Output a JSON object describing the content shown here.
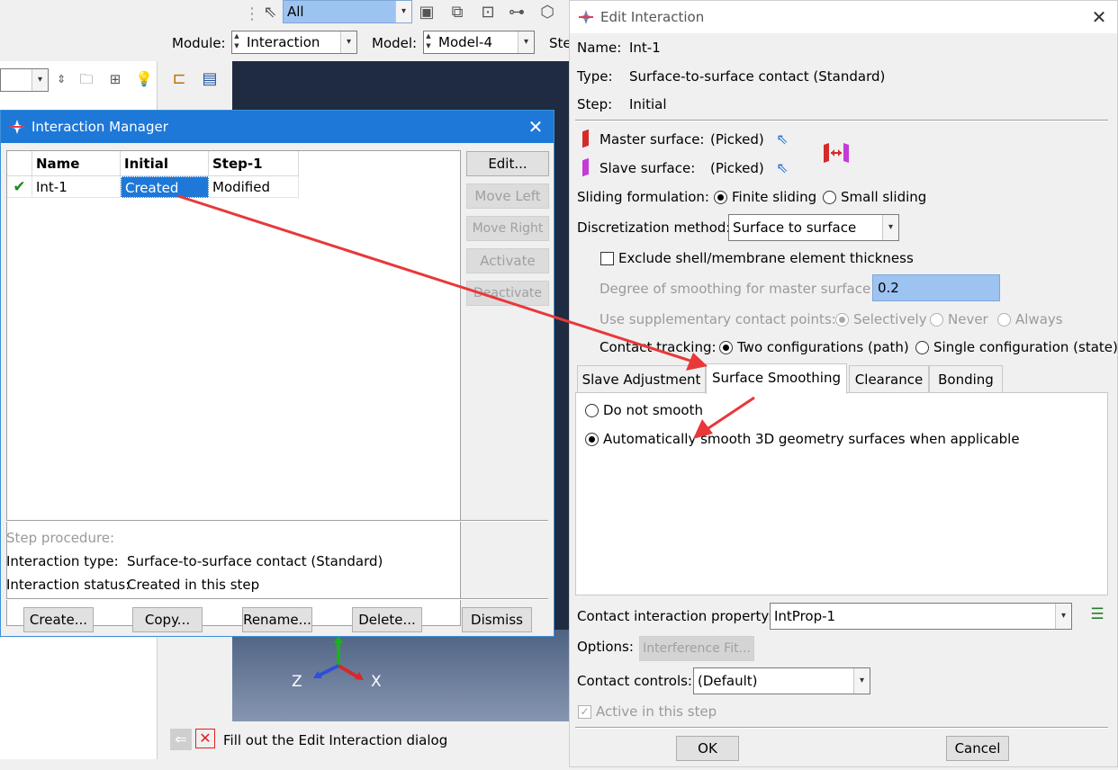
{
  "toolbar": {
    "selection_filter": "All"
  },
  "module_bar": {
    "module_label": "Module:",
    "module_value": "Interaction",
    "model_label": "Model:",
    "model_value": "Model-4",
    "step_label_partial": "Ste"
  },
  "viewport": {
    "axis_z": "Z",
    "axis_x": "X"
  },
  "prompt": {
    "text": "Fill out the Edit Interaction dialog"
  },
  "manager": {
    "title": "Interaction Manager",
    "columns": [
      "Name",
      "Initial",
      "Step-1"
    ],
    "rows": [
      {
        "name": "Int-1",
        "initial": "Created",
        "step1": "Modified"
      }
    ],
    "side_buttons": {
      "edit": "Edit...",
      "move_left": "Move Left",
      "move_right": "Move Right",
      "activate": "Activate",
      "deactivate": "Deactivate"
    },
    "step_procedure_label": "Step procedure:",
    "interaction_type_label": "Interaction type:",
    "interaction_type_value": "Surface-to-surface contact (Standard)",
    "interaction_status_label": "Interaction status:",
    "interaction_status_value": "Created in this step",
    "bottom_buttons": {
      "create": "Create...",
      "copy": "Copy...",
      "rename": "Rename...",
      "delete": "Delete...",
      "dismiss": "Dismiss"
    }
  },
  "edit": {
    "title": "Edit Interaction",
    "name_label": "Name:",
    "name_value": "Int-1",
    "type_label": "Type:",
    "type_value": "Surface-to-surface contact (Standard)",
    "step_label": "Step:",
    "step_value": "Initial",
    "master_surface_label": "Master surface:",
    "master_surface_value": "(Picked)",
    "slave_surface_label": "Slave surface:",
    "slave_surface_value": "(Picked)",
    "sliding_label": "Sliding formulation:",
    "sliding_finite": "Finite sliding",
    "sliding_small": "Small sliding",
    "discretization_label": "Discretization method:",
    "discretization_value": "Surface to surface",
    "exclude_shell": "Exclude shell/membrane element thickness",
    "degree_smoothing_label": "Degree of smoothing for master surface:",
    "degree_smoothing_value": "0.2",
    "supplementary_label": "Use supplementary contact points:",
    "supp_selectively": "Selectively",
    "supp_never": "Never",
    "supp_always": "Always",
    "tracking_label": "Contact tracking:",
    "tracking_two": "Two configurations (path)",
    "tracking_single": "Single configuration (state)",
    "tabs": [
      "Slave Adjustment",
      "Surface Smoothing",
      "Clearance",
      "Bonding"
    ],
    "smooth_none": "Do not smooth",
    "smooth_auto": "Automatically smooth 3D geometry surfaces when applicable",
    "property_label": "Contact interaction property:",
    "property_value": "IntProp-1",
    "options_label": "Options:",
    "interference_button": "Interference Fit...",
    "controls_label": "Contact controls:",
    "controls_value": "(Default)",
    "active_label": "Active in this step",
    "ok": "OK",
    "cancel": "Cancel"
  },
  "colors": {
    "accent": "#1e78d7",
    "arrow": "#e8383a",
    "viewport_dark": "#1f2b40"
  }
}
